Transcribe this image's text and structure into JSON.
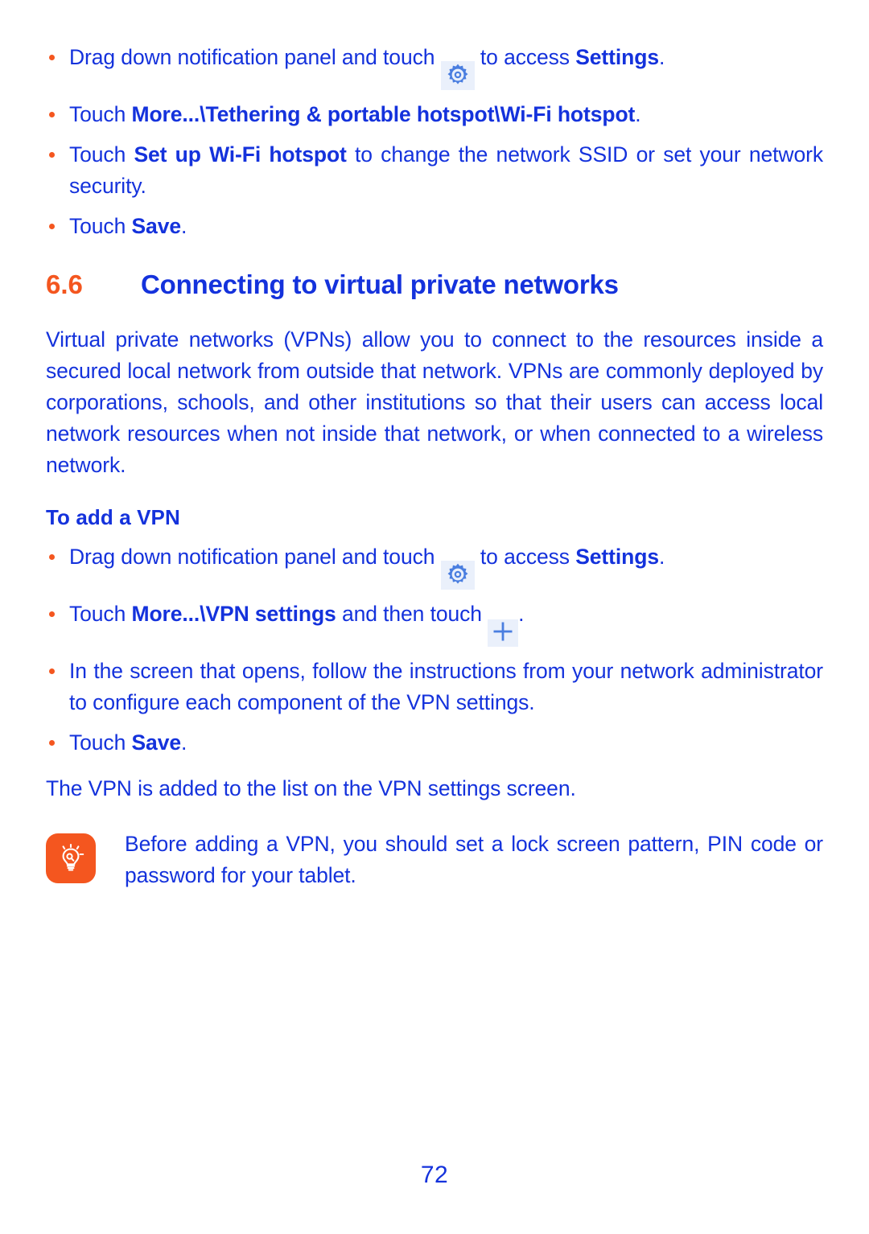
{
  "page": {
    "number": "72",
    "text_color": "#1432dc",
    "accent_color": "#f4561f",
    "icon_bg_color": "#eaf0fb",
    "background": "#ffffff"
  },
  "top_steps": [
    {
      "id": "drag-down-settings",
      "pre": "Drag down notification panel and touch ",
      "icon": "gear-icon",
      "mid": " to access ",
      "bold": "Settings",
      "post": "."
    },
    {
      "id": "touch-tethering-hotspot",
      "pre": "Touch ",
      "bold": "More...\\Tethering & portable hotspot\\Wi-Fi hotspot",
      "post": "."
    },
    {
      "id": "touch-setup-hotspot",
      "pre": "Touch ",
      "bold": "Set up Wi-Fi hotspot",
      "post": " to change the network SSID or set your network security."
    },
    {
      "id": "touch-save-top",
      "pre": "Touch ",
      "bold": "Save",
      "post": "."
    }
  ],
  "section": {
    "number": "6.6",
    "title": "Connecting to virtual private networks",
    "body": "Virtual private networks (VPNs) allow you to connect to the resources inside a secured local network from outside that network. VPNs are commonly deployed by corporations, schools, and other institutions so that their users can access local network resources when not inside that network, or when connected to a wireless network."
  },
  "subsection": {
    "heading": "To add a VPN",
    "steps": [
      {
        "id": "drag-down-settings-2",
        "pre": "Drag down notification panel and touch ",
        "icon": "gear-icon",
        "mid": " to access ",
        "bold": "Settings",
        "post": "."
      },
      {
        "id": "touch-vpn-settings",
        "pre": "Touch ",
        "bold": "More...\\VPN settings",
        "mid": " and then touch ",
        "icon": "plus-icon",
        "post": "."
      },
      {
        "id": "follow-instructions",
        "pre": "In the screen that opens, follow the instructions from your network administrator to configure each component of the VPN settings.",
        "bold": "",
        "post": ""
      },
      {
        "id": "touch-save-bottom",
        "pre": "Touch ",
        "bold": "Save",
        "post": "."
      }
    ],
    "closing": "The VPN is added to the list on the VPN settings screen."
  },
  "tip": {
    "icon": "lightbulb-icon",
    "text": "Before adding a VPN, you should set a lock screen pattern, PIN code or password for your tablet."
  }
}
